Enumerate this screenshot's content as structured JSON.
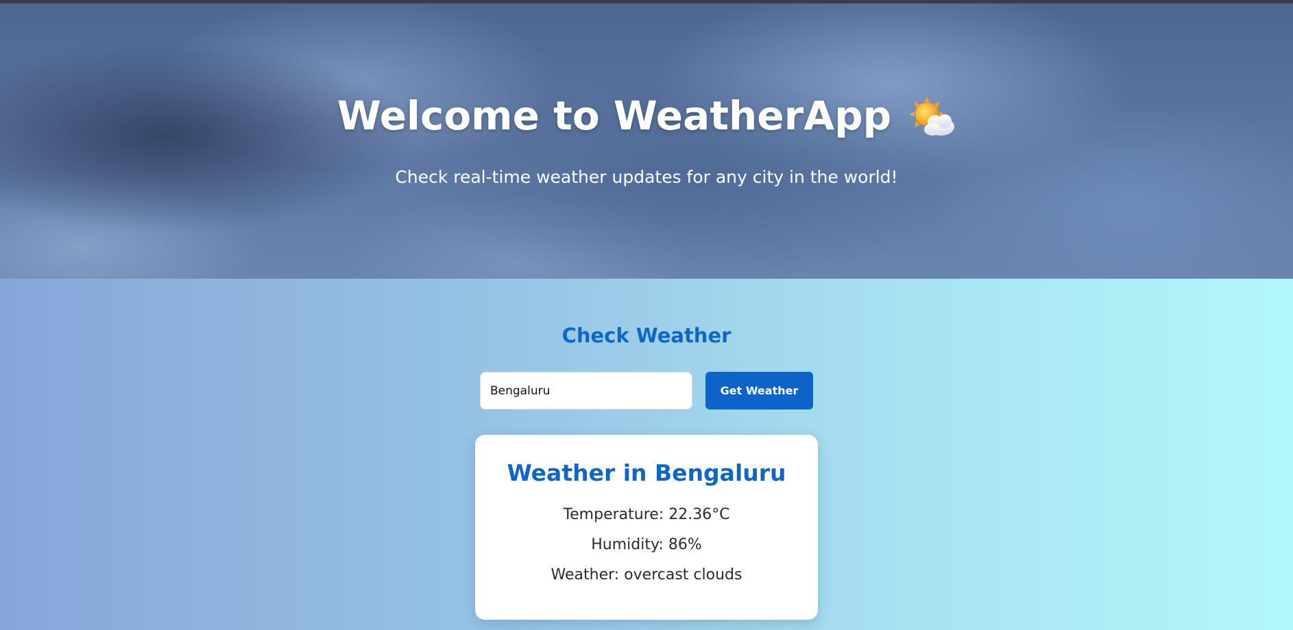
{
  "hero": {
    "title": "Welcome to WeatherApp",
    "icon": "sun-behind-cloud-icon",
    "subtitle": "Check real-time weather updates for any city in the world!"
  },
  "search": {
    "heading": "Check Weather",
    "input_value": "Bengaluru",
    "button_label": "Get Weather"
  },
  "result": {
    "title": "Weather in Bengaluru",
    "temperature": "Temperature: 22.36°C",
    "humidity": "Humidity: 86%",
    "weather": "Weather: overcast clouds"
  },
  "colors": {
    "accent": "#0d63c7",
    "heading": "#1066c6",
    "card_bg": "#ffffff"
  }
}
